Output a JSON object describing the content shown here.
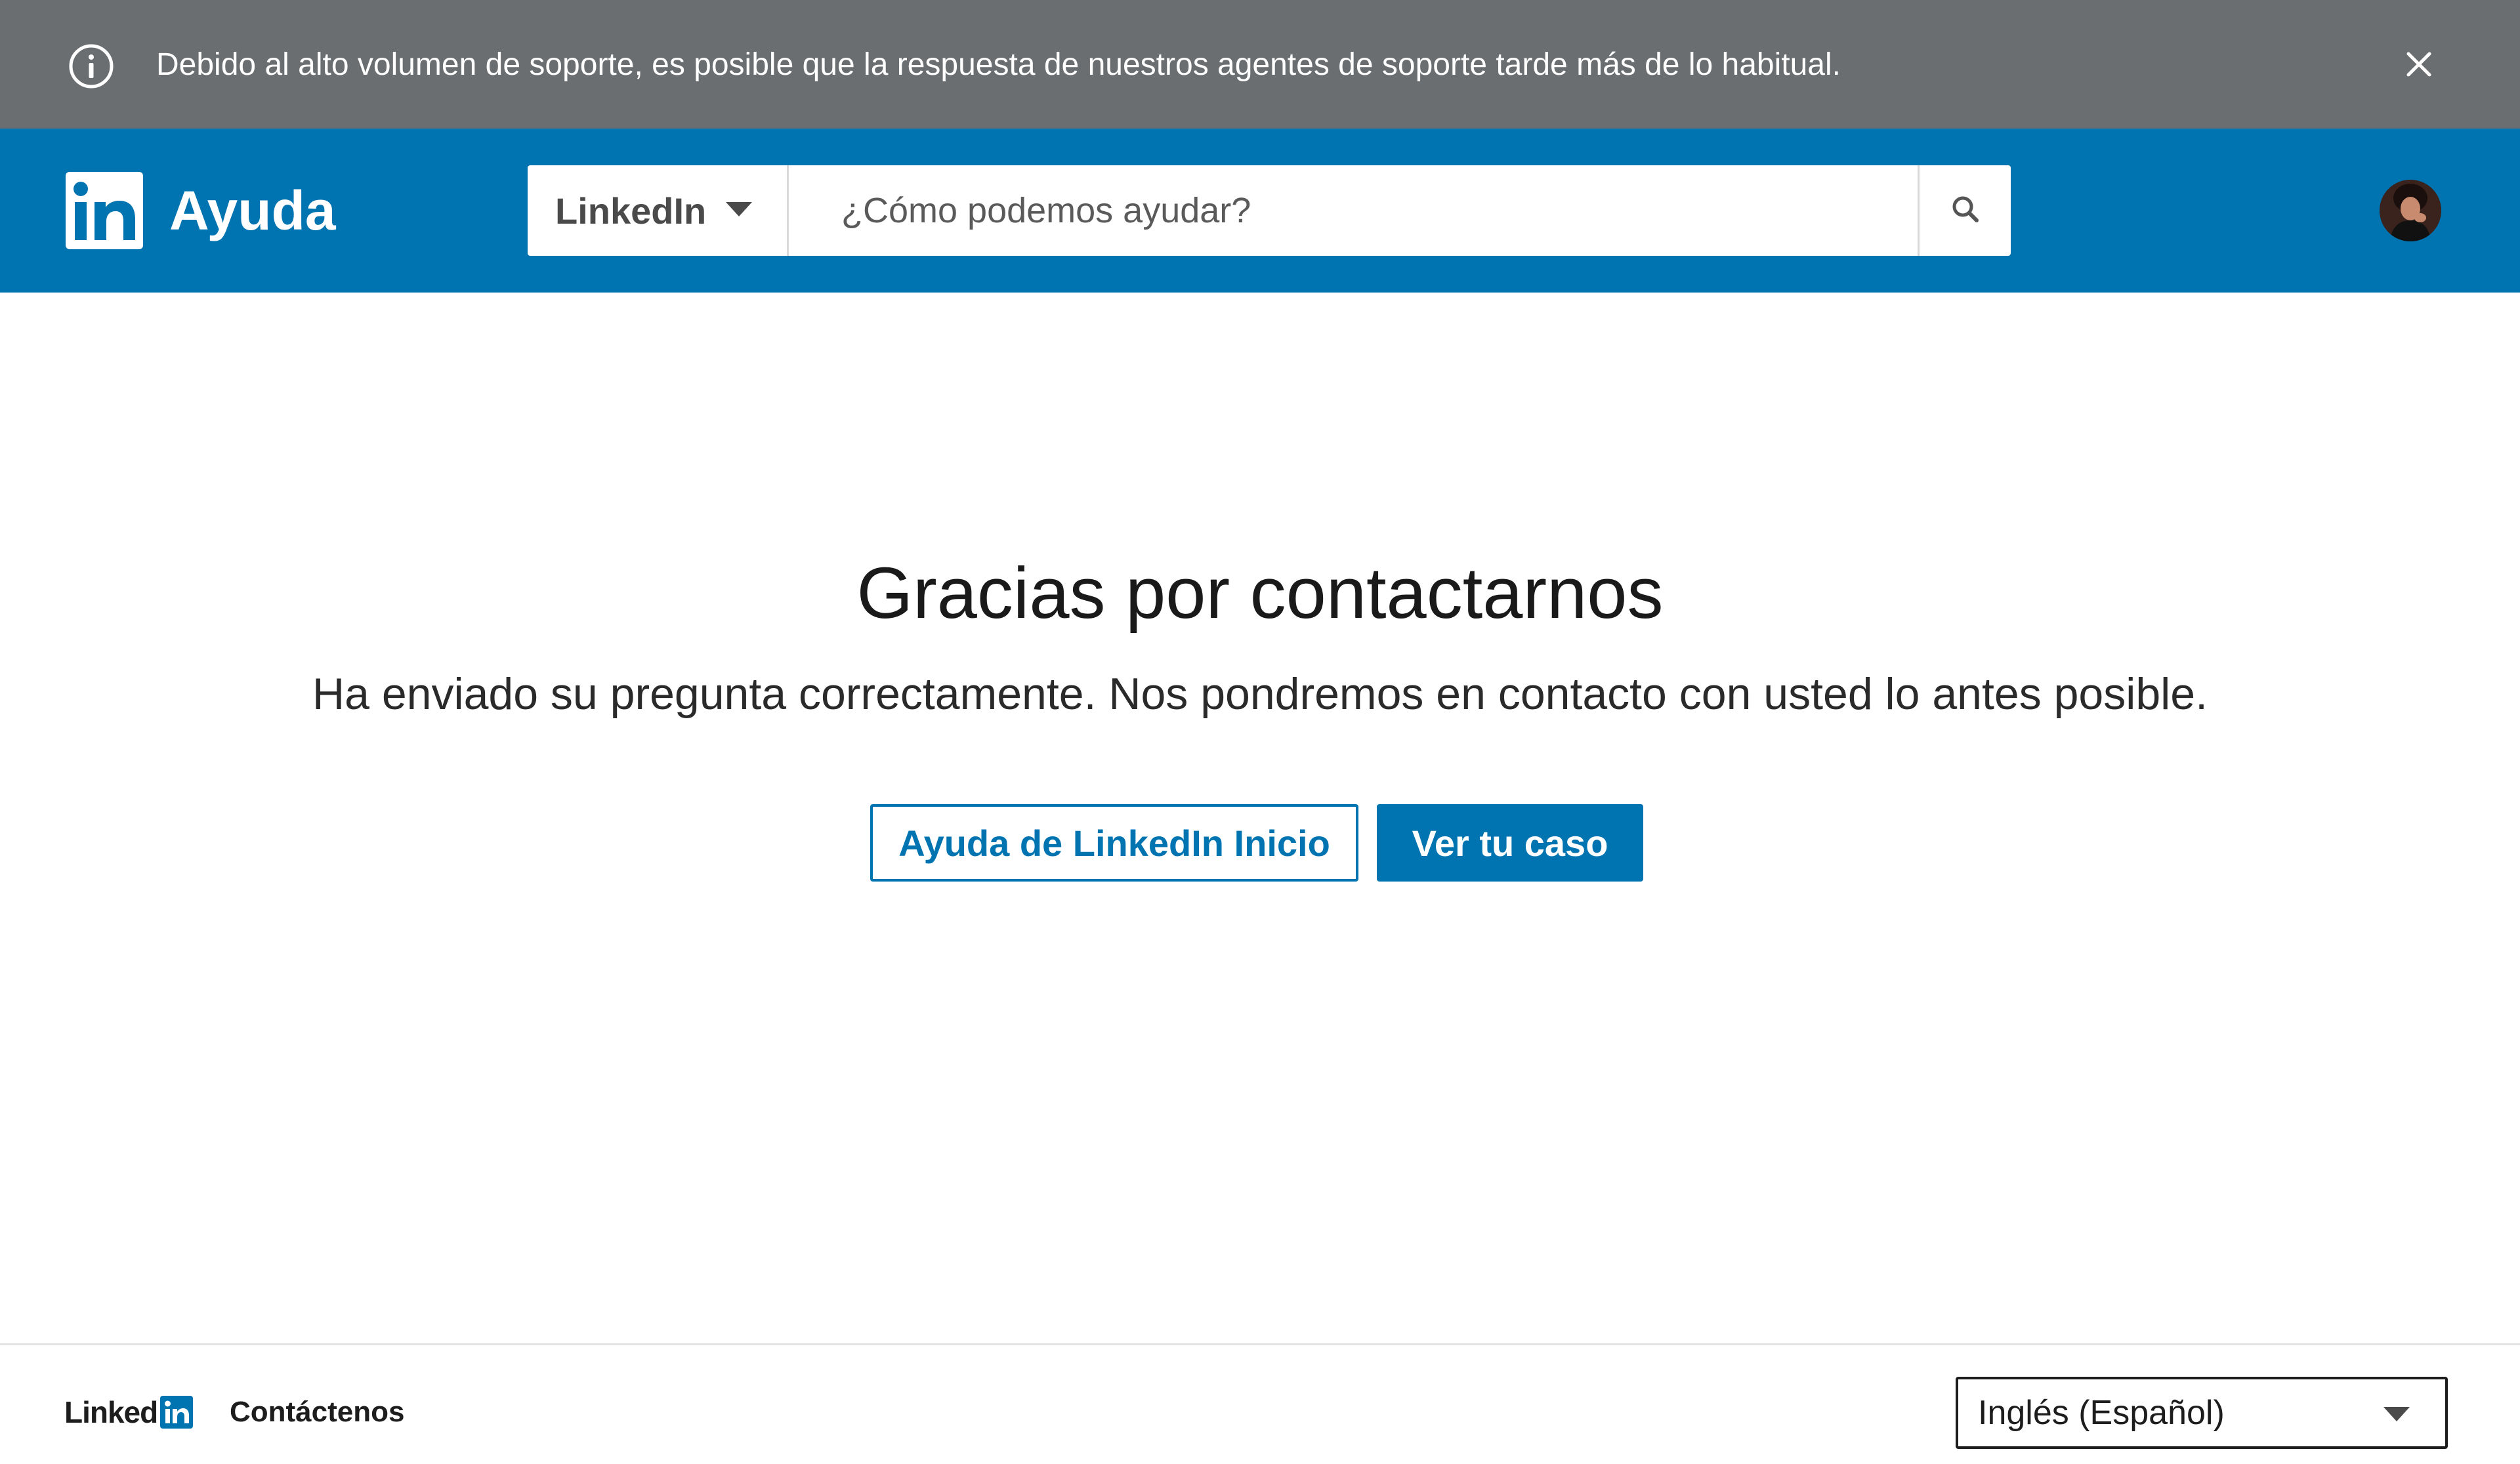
{
  "notice": {
    "message": "Debido al alto volumen de soporte, es posible que la respuesta de nuestros agentes de soporte tarde más de lo habitual.",
    "icon": "info-icon",
    "close_icon": "close-icon"
  },
  "header": {
    "logo_icon": "linkedin-logo-icon",
    "logo_letters": "in",
    "title": "Ayuda",
    "product_select": {
      "selected": "LinkedIn",
      "icon": "chevron-down-icon"
    },
    "search": {
      "placeholder": "¿Cómo podemos ayudar?",
      "value": "",
      "icon": "search-icon"
    },
    "avatar_icon": "user-avatar"
  },
  "main": {
    "title": "Gracias por contactarnos",
    "subtitle": "Ha enviado su pregunta correctamente. Nos pondremos en contacto con usted lo antes posible.",
    "home_button_label": "Ayuda de LinkedIn Inicio",
    "case_button_label": "Ver tu caso"
  },
  "footer": {
    "logo_word": "Linked",
    "logo_box_letters": "in",
    "contact_link": "Contáctenos",
    "language_select": {
      "selected": "Inglés (Español)",
      "icon": "chevron-down-icon"
    }
  },
  "colors": {
    "brand_blue": "#0073b1",
    "notice_gray": "#6b6e70",
    "white": "#ffffff"
  }
}
